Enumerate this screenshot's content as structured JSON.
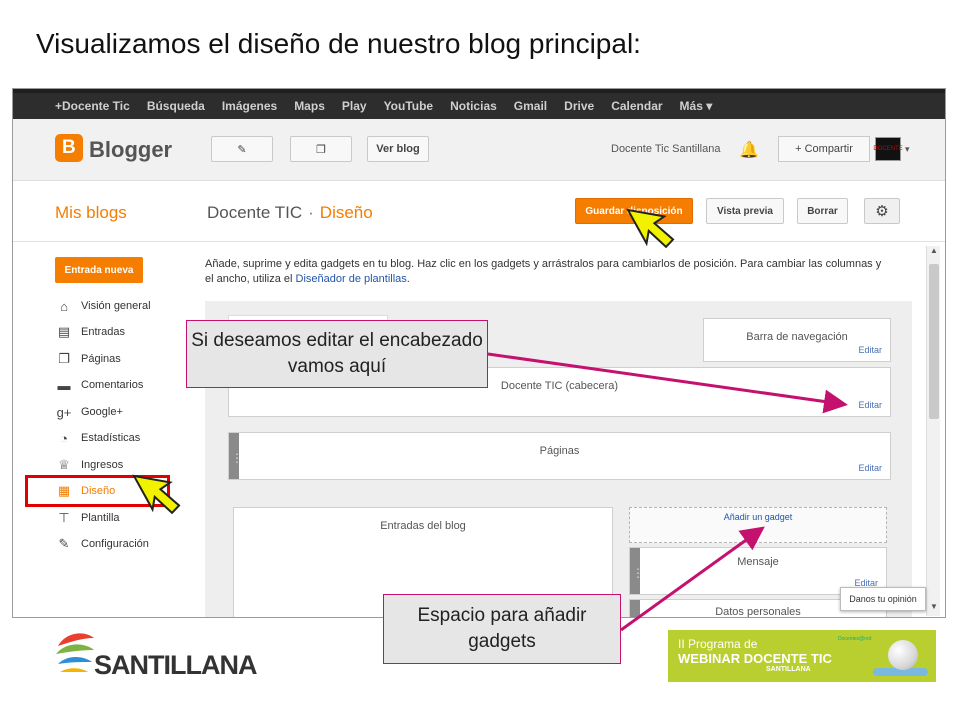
{
  "slide": {
    "title": "Visualizamos el diseño de nuestro blog principal:"
  },
  "google_bar": {
    "items": [
      "+Docente Tic",
      "Búsqueda",
      "Imágenes",
      "Maps",
      "Play",
      "YouTube",
      "Noticias",
      "Gmail",
      "Drive",
      "Calendar",
      "Más ▾"
    ]
  },
  "header": {
    "logo": "Blogger",
    "pen_icon": "✎",
    "pages_icon": "❐",
    "view_blog": "Ver blog",
    "user": "Docente Tic Santillana",
    "bell_icon": "🔔",
    "share": "+ Compartir",
    "avatar_text": "DOCENTE",
    "avatar_caret": "▾"
  },
  "title_row": {
    "my_blogs": "Mis blogs",
    "blog_name": "Docente TIC",
    "separator": "·",
    "section": "Diseño",
    "save_layout": "Guardar disposición",
    "preview": "Vista previa",
    "clear": "Borrar",
    "gear_icon": "⚙"
  },
  "sidebar": {
    "new_post": "Entrada nueva",
    "items": [
      {
        "label": "Visión general",
        "icon": "home-icon",
        "glyph": "⌂"
      },
      {
        "label": "Entradas",
        "icon": "posts-icon",
        "glyph": "▤"
      },
      {
        "label": "Páginas",
        "icon": "pages-icon",
        "glyph": "❐"
      },
      {
        "label": "Comentarios",
        "icon": "comments-icon",
        "glyph": "▬"
      },
      {
        "label": "Google+",
        "icon": "googleplus-icon",
        "glyph": "g+"
      },
      {
        "label": "Estadísticas",
        "icon": "stats-icon",
        "glyph": "◔"
      },
      {
        "label": "Ingresos",
        "icon": "trophy-icon",
        "glyph": "♕"
      },
      {
        "label": "Diseño",
        "icon": "layout-icon",
        "glyph": "▦"
      },
      {
        "label": "Plantilla",
        "icon": "template-icon",
        "glyph": "⊤"
      },
      {
        "label": "Configuración",
        "icon": "wrench-icon",
        "glyph": "✎"
      }
    ]
  },
  "content": {
    "description": "Añade, suprime y edita gadgets en tu blog. Haz clic en los gadgets y arrástralos para cambiarlos de posición. Para cambiar las columnas y el ancho, utiliza el ",
    "description_link": "Diseñador de plantillas",
    "description_end": ".",
    "navbar_widget": "Barra de navegación",
    "header_widget": "Docente TIC (cabecera)",
    "pages_widget": "Páginas",
    "posts_widget": "Entradas del blog",
    "add_gadget": "Añadir un gadget",
    "message_widget": "Mensaje",
    "profile_widget": "Datos personales",
    "edit": "Editar",
    "feedback": "Danos tu opinión",
    "scroll_up": "▲",
    "scroll_down": "▼"
  },
  "callouts": {
    "header_hint": "Si deseamos editar el encabezado vamos aquí",
    "gadgets_hint": "Espacio para añadir gadgets"
  },
  "footer": {
    "santillana": "SANTILLANA",
    "webinar_line1": "II Programa de",
    "webinar_line2": "WEBINAR DOCENTE TIC",
    "webinar_line3": "SANTILLANA",
    "webinar_small": "Docentes@red"
  },
  "colors": {
    "blogger_orange": "#f57d00",
    "callout_border": "#c4106e",
    "highlight_red": "#e00000",
    "webinar_green": "#b9cf2f"
  }
}
